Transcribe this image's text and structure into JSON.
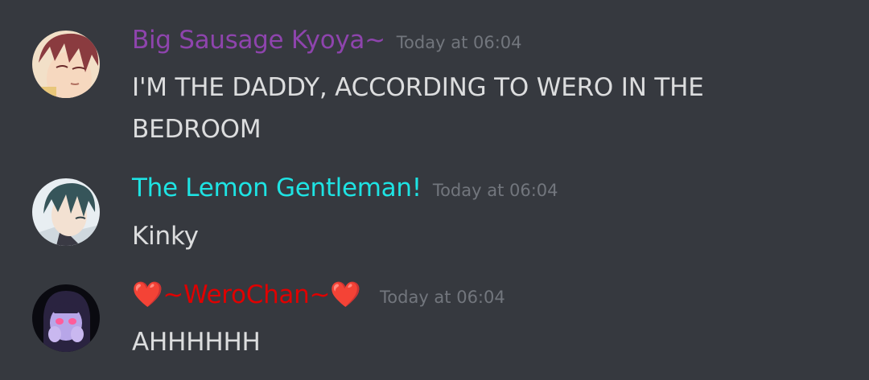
{
  "messages": [
    {
      "username": "Big Sausage Kyoya~",
      "username_color": "#8e44ad",
      "timestamp": "Today at 06:04",
      "lines": [
        "I'M THE DADDY, ACCORDING TO WERO IN THE",
        "BEDROOM"
      ]
    },
    {
      "username": "The Lemon Gentleman!",
      "username_color": "#1abc9c",
      "timestamp": "Today at 06:04",
      "lines": [
        "Kinky"
      ]
    },
    {
      "username_prefix": "❤️",
      "username": "~WeroChan~",
      "username_suffix": "❤️",
      "username_color": "#e00000",
      "timestamp": "Today at 06:04",
      "lines": [
        "AHHHHHH"
      ]
    }
  ],
  "colors": {
    "background": "#36393f",
    "timestamp": "#72767d",
    "text": "#dcddde"
  }
}
